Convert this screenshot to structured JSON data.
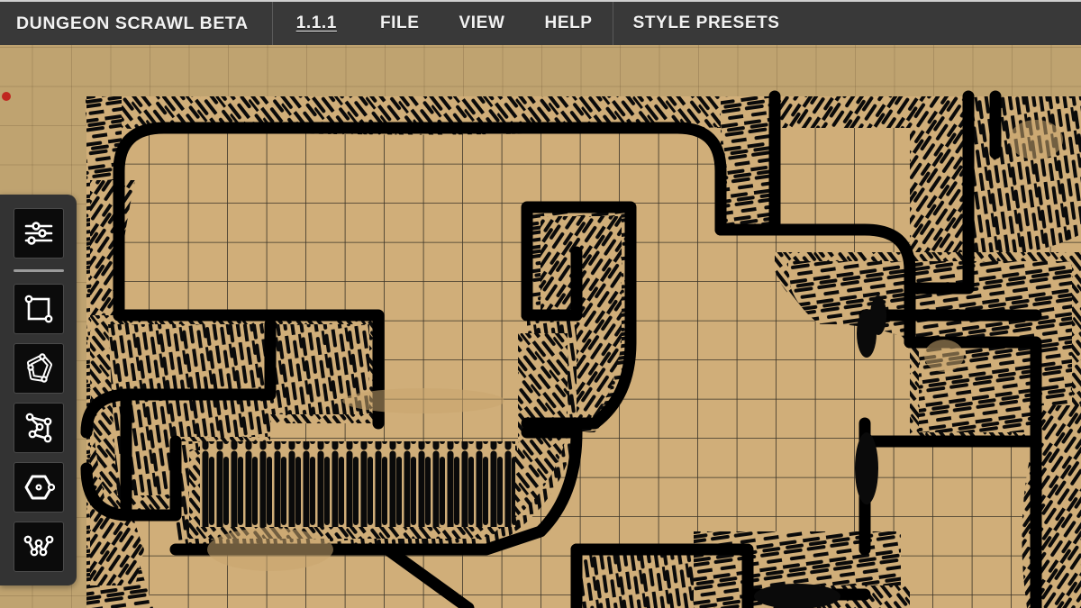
{
  "app": {
    "title": "DUNGEON SCRAWL BETA",
    "version": "1.1.1"
  },
  "menubar": {
    "items": [
      {
        "id": "brand",
        "label": "DUNGEON SCRAWL BETA",
        "kind": "brand"
      },
      {
        "id": "version",
        "label": "1.1.1",
        "kind": "link"
      },
      {
        "id": "file",
        "label": "FILE",
        "kind": "menu"
      },
      {
        "id": "view",
        "label": "VIEW",
        "kind": "menu"
      },
      {
        "id": "help",
        "label": "HELP",
        "kind": "menu"
      },
      {
        "id": "style_presets",
        "label": "STYLE PRESETS",
        "kind": "menu"
      }
    ]
  },
  "toolpanel": {
    "tools": [
      {
        "id": "settings",
        "icon": "sliders-icon",
        "label": "Settings"
      },
      {
        "id": "rectangle",
        "icon": "rectangle-tool-icon",
        "label": "Rectangle"
      },
      {
        "id": "blob",
        "icon": "blob-tool-icon",
        "label": "Blob"
      },
      {
        "id": "polygon",
        "icon": "polygon-tool-icon",
        "label": "Polygon"
      },
      {
        "id": "hexagon",
        "icon": "hexagon-tool-icon",
        "label": "Hexagon"
      },
      {
        "id": "path",
        "icon": "path-tool-icon",
        "label": "Path"
      }
    ]
  },
  "canvas": {
    "marker": {
      "id": "vertex-marker",
      "color": "#c0261f"
    },
    "grid_size_px": 43.5
  },
  "colors": {
    "menubar_bg": "#393939",
    "menubar_text": "#f2f2f2",
    "panel_bg": "#333333",
    "tool_bg": "#0b0b0b",
    "floor": "#d0ae79",
    "backdrop": "#bfa370",
    "wall": "#000000",
    "grid_line": "#3a3428"
  }
}
